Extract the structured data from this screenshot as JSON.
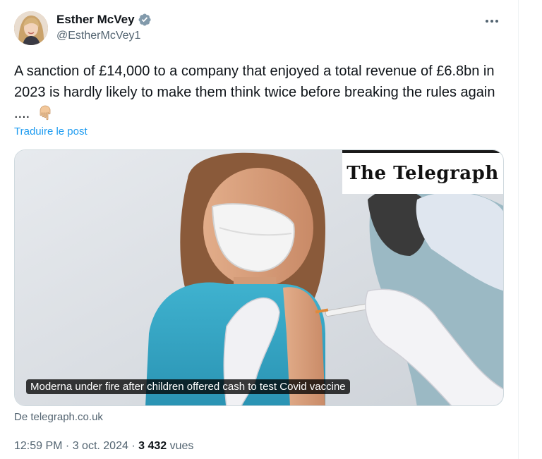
{
  "author": {
    "name": "Esther McVey",
    "handle": "@EstherMcVey1",
    "verified": true
  },
  "tweet": {
    "text": "A sanction of £14,000 to a company that enjoyed a total revenue of £6.8bn in 2023 is hardly likely to make them think twice before breaking the rules again ....",
    "emoji_icon": "pointing-down-emoji-icon",
    "translate_label": "Traduire le post"
  },
  "card": {
    "brand": "The Telegraph",
    "caption": "Moderna under fire after children offered cash to test Covid vaccine",
    "source": "De telegraph.co.uk"
  },
  "meta": {
    "time": "12:59 PM",
    "separator": " · ",
    "date": "3 oct. 2024",
    "views_count": "3 432",
    "views_label": " vues"
  },
  "colors": {
    "accent": "#1d9bf0",
    "verified": "#829aab",
    "secondary_text": "#536471"
  }
}
